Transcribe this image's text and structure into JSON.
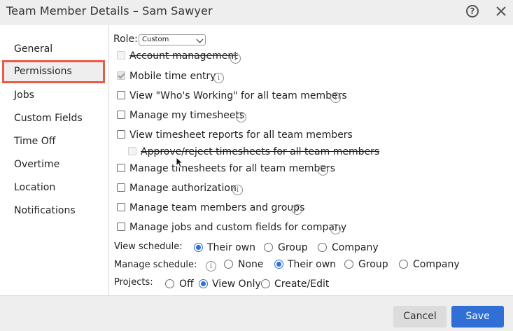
{
  "window": {
    "title": "Team Member Details – Sam Sawyer"
  },
  "sidebar": {
    "items": [
      {
        "label": "General"
      },
      {
        "label": "Permissions",
        "active": true
      },
      {
        "label": "Jobs"
      },
      {
        "label": "Custom Fields"
      },
      {
        "label": "Time Off"
      },
      {
        "label": "Overtime"
      },
      {
        "label": "Location"
      },
      {
        "label": "Notifications"
      }
    ]
  },
  "permissions": {
    "role_label": "Role:",
    "role_value": "Custom",
    "checkboxes": [
      {
        "label": "Account management",
        "state": "disabled",
        "strikethrough": true,
        "info": true
      },
      {
        "label": "Mobile time entry",
        "state": "checked-disabled",
        "info": true
      },
      {
        "label": "View \"Who's Working\" for all team members",
        "state": "unchecked",
        "info": true
      },
      {
        "label": "Manage my timesheets",
        "state": "unchecked",
        "info": true
      },
      {
        "label": "View timesheet reports for all team members",
        "state": "unchecked",
        "info": false
      },
      {
        "label": "Approve/reject timesheets for all team members",
        "state": "disabled",
        "strikethrough": true,
        "info": false
      },
      {
        "label": "Manage timesheets for all team members",
        "state": "unchecked",
        "info": true
      },
      {
        "label": "Manage authorization",
        "state": "unchecked",
        "info": true
      },
      {
        "label": "Manage team members and groups",
        "state": "unchecked",
        "info": true
      },
      {
        "label": "Manage jobs and custom fields for company",
        "state": "unchecked",
        "info": true
      }
    ],
    "view_schedule": {
      "label": "View schedule:",
      "options": [
        "Their own",
        "Group",
        "Company"
      ],
      "selected": "Their own"
    },
    "manage_schedule": {
      "label": "Manage schedule:",
      "options": [
        "None",
        "Their own",
        "Group",
        "Company"
      ],
      "selected": "Their own"
    },
    "projects": {
      "label": "Projects:",
      "options": [
        "Off",
        "View Only",
        "Create/Edit"
      ],
      "selected": "View Only"
    }
  },
  "footer": {
    "cancel_label": "Cancel",
    "save_label": "Save"
  },
  "colors": {
    "accent": "#2f6fd6",
    "highlight_border": "#ec5b47"
  }
}
